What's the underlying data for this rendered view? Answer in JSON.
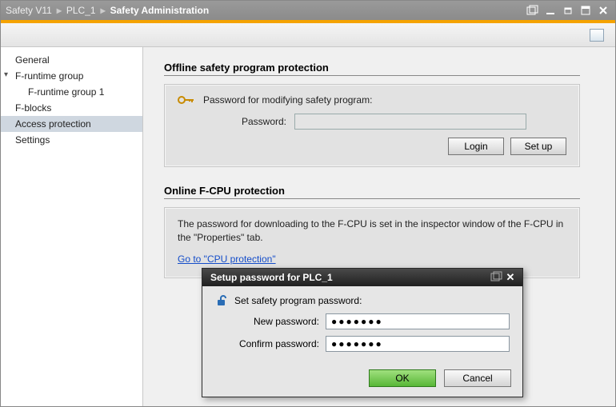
{
  "breadcrumb": {
    "seg1": "Safety V11",
    "seg2": "PLC_1",
    "seg3": "Safety Administration"
  },
  "sidebar": {
    "items": [
      {
        "label": "General"
      },
      {
        "label": "F-runtime group"
      },
      {
        "label": "F-runtime group 1"
      },
      {
        "label": "F-blocks"
      },
      {
        "label": "Access protection"
      },
      {
        "label": "Settings"
      }
    ]
  },
  "offline": {
    "title": "Offline safety program protection",
    "legend": "Password for modifying safety program:",
    "password_label": "Password:",
    "login_label": "Login",
    "setup_label": "Set up"
  },
  "online": {
    "title": "Online F-CPU protection",
    "text": "The password for downloading to the F-CPU is set in the inspector window of the F-CPU in the \"Properties\" tab.",
    "link": "Go to \"CPU protection\""
  },
  "dialog": {
    "title": "Setup password for PLC_1",
    "legend": "Set safety program password:",
    "newpw_label": "New password:",
    "confirmpw_label": "Confirm password:",
    "newpw_value": "●●●●●●●",
    "confirmpw_value": "●●●●●●●",
    "ok_label": "OK",
    "cancel_label": "Cancel"
  }
}
